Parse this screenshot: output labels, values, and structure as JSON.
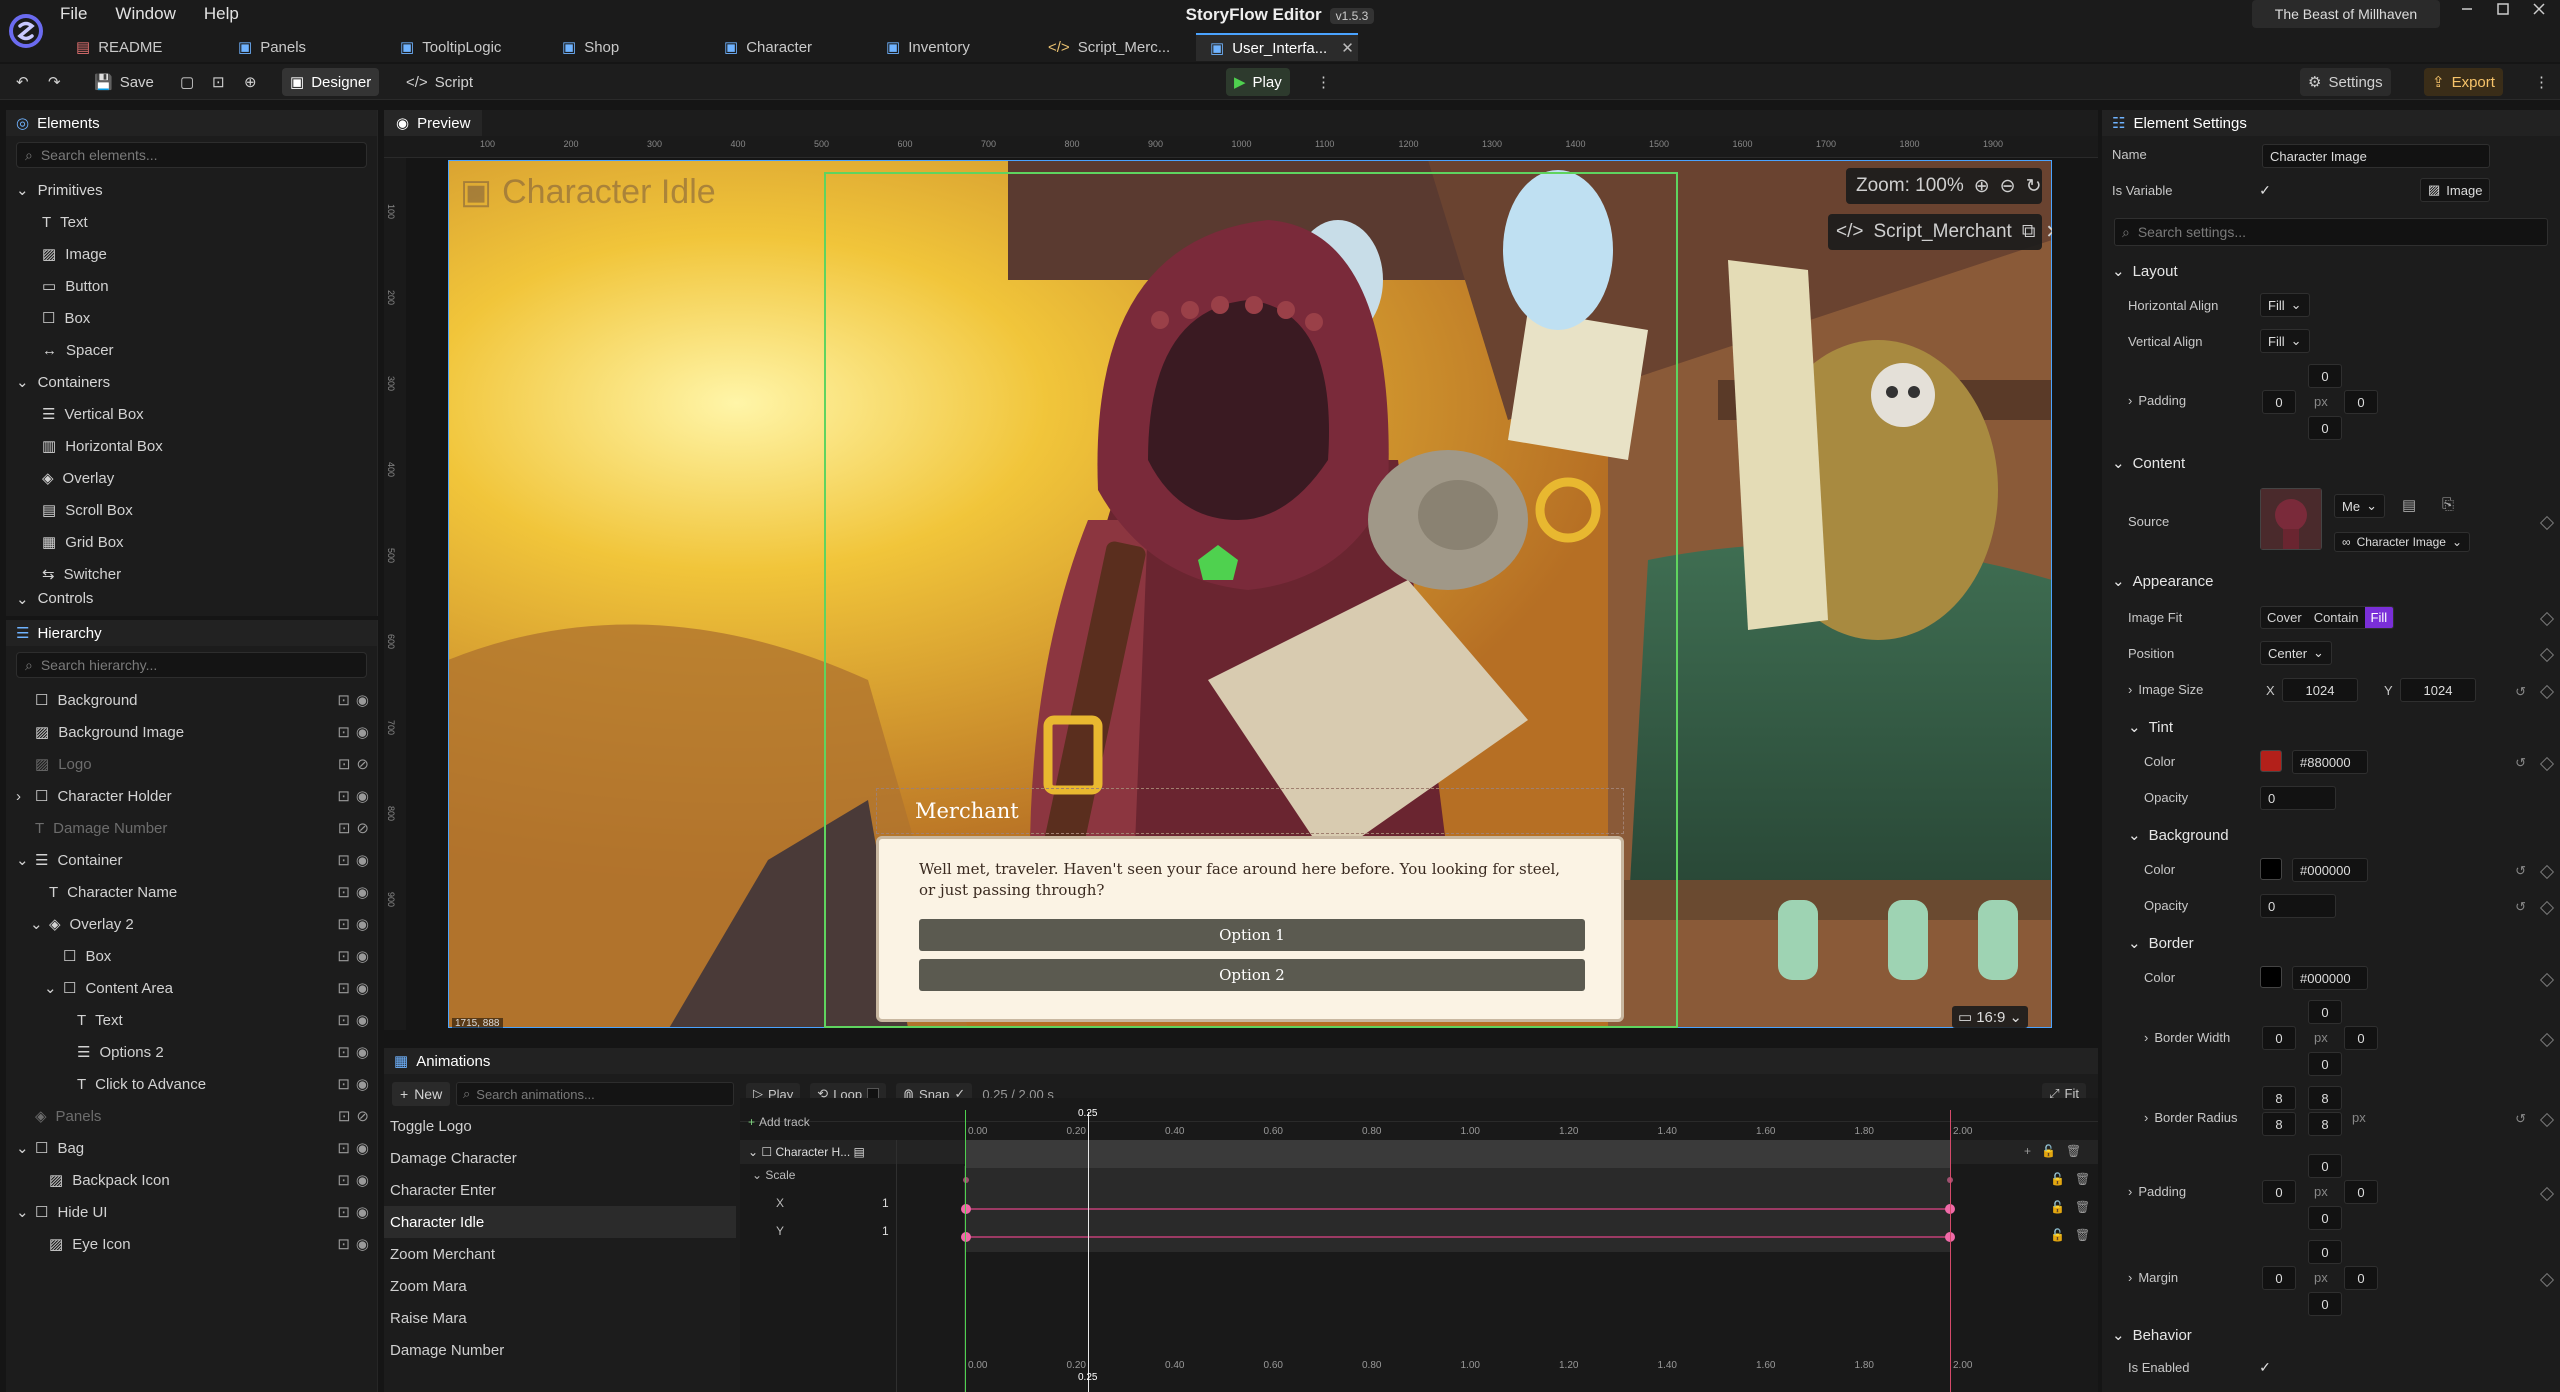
{
  "app": {
    "title": "StoryFlow Editor",
    "version": "v1.5.3",
    "project": "The Beast of Millhaven",
    "menu": [
      "File",
      "Window",
      "Help"
    ]
  },
  "tabs": [
    {
      "label": "README",
      "icon": "file-icon"
    },
    {
      "label": "Panels",
      "icon": "layout-icon"
    },
    {
      "label": "TooltipLogic",
      "icon": "layout-icon"
    },
    {
      "label": "Shop",
      "icon": "layout-icon"
    },
    {
      "label": "Character",
      "icon": "layout-icon"
    },
    {
      "label": "Inventory",
      "icon": "layout-icon"
    },
    {
      "label": "Script_Merc...",
      "icon": "code-icon"
    },
    {
      "label": "User_Interfa...",
      "icon": "layout-icon",
      "active": true
    }
  ],
  "toolbar": {
    "save": "Save",
    "designer": "Designer",
    "script": "Script",
    "play": "Play",
    "settings": "Settings",
    "export": "Export"
  },
  "elements": {
    "title": "Elements",
    "search_placeholder": "Search elements...",
    "primitives_label": "Primitives",
    "primitives": [
      "Text",
      "Image",
      "Button",
      "Box",
      "Spacer"
    ],
    "containers_label": "Containers",
    "containers": [
      "Vertical Box",
      "Horizontal Box",
      "Overlay",
      "Scroll Box",
      "Grid Box",
      "Switcher"
    ],
    "controls_label": "Controls"
  },
  "hierarchy": {
    "title": "Hierarchy",
    "search_placeholder": "Search hierarchy...",
    "items": [
      {
        "label": "Background",
        "depth": 0,
        "icon": "box",
        "dim": false
      },
      {
        "label": "Background Image",
        "depth": 0,
        "icon": "image",
        "dim": false
      },
      {
        "label": "Logo",
        "depth": 0,
        "icon": "image",
        "dim": true
      },
      {
        "label": "Character Holder",
        "depth": 0,
        "icon": "box",
        "dim": false,
        "caret": "right"
      },
      {
        "label": "Damage Number",
        "depth": 0,
        "icon": "text",
        "dim": true
      },
      {
        "label": "Container",
        "depth": 0,
        "icon": "vbox",
        "dim": false,
        "caret": "down"
      },
      {
        "label": "Character Name",
        "depth": 1,
        "icon": "text",
        "dim": false
      },
      {
        "label": "Overlay 2",
        "depth": 1,
        "icon": "layers",
        "dim": false,
        "caret": "down"
      },
      {
        "label": "Box",
        "depth": 2,
        "icon": "box",
        "dim": false
      },
      {
        "label": "Content Area",
        "depth": 2,
        "icon": "box",
        "dim": false,
        "caret": "down"
      },
      {
        "label": "Text",
        "depth": 3,
        "icon": "text",
        "dim": false
      },
      {
        "label": "Options 2",
        "depth": 3,
        "icon": "vbox",
        "dim": false
      },
      {
        "label": "Click to Advance",
        "depth": 3,
        "icon": "text",
        "dim": false
      },
      {
        "label": "Panels",
        "depth": 0,
        "icon": "layers",
        "dim": true
      },
      {
        "label": "Bag",
        "depth": 0,
        "icon": "box",
        "dim": false,
        "caret": "down"
      },
      {
        "label": "Backpack Icon",
        "depth": 1,
        "icon": "image",
        "dim": false
      },
      {
        "label": "Hide UI",
        "depth": 0,
        "icon": "box",
        "dim": false,
        "caret": "down"
      },
      {
        "label": "Eye Icon",
        "depth": 1,
        "icon": "image",
        "dim": false
      }
    ]
  },
  "preview": {
    "title": "Preview",
    "overlay_title": "Character Idle",
    "zoom": "Zoom: 100%",
    "script_label": "Script_Merchant",
    "coords": "1715, 888",
    "aspect": "16:9",
    "ruler": [
      "100",
      "200",
      "300",
      "400",
      "500",
      "600",
      "700",
      "800",
      "900",
      "1000",
      "1100",
      "1200",
      "1300",
      "1400",
      "1500",
      "1600",
      "1700",
      "1800",
      "1900"
    ],
    "ruler_left": [
      "100",
      "200",
      "300",
      "400",
      "500",
      "600",
      "700",
      "800",
      "900"
    ],
    "dialog": {
      "speaker": "Merchant",
      "text": "Well met, traveler. Haven't seen your face around here before. You looking for steel, or just passing through?",
      "option1": "Option 1",
      "option2": "Option 2"
    }
  },
  "settings": {
    "title": "Element Settings",
    "name_label": "Name",
    "name_value": "Character Image",
    "is_variable": "Is Variable",
    "type_badge": "Image",
    "search_placeholder": "Search settings...",
    "layout": "Layout",
    "h_align": "Horizontal Align",
    "h_align_val": "Fill",
    "v_align": "Vertical Align",
    "v_align_val": "Fill",
    "padding": "Padding",
    "zero": "0",
    "px": "px",
    "content": "Content",
    "source": "Source",
    "source_mode": "Me",
    "source_var": "Character Image",
    "appearance": "Appearance",
    "image_fit": "Image Fit",
    "fit_opts": [
      "Cover",
      "Contain",
      "Fill"
    ],
    "position": "Position",
    "position_val": "Center",
    "image_size": "Image Size",
    "x": "X",
    "y": "Y",
    "size_x": "1024",
    "size_y": "1024",
    "tint": "Tint",
    "color": "Color",
    "tint_hex": "#880000",
    "tint_color": "#b3201a",
    "opacity": "Opacity",
    "background": "Background",
    "bg_hex": "#000000",
    "border": "Border",
    "border_hex": "#000000",
    "border_width": "Border Width",
    "border_radius": "Border Radius",
    "eight": "8",
    "margin": "Margin",
    "behavior": "Behavior",
    "is_enabled": "Is Enabled"
  },
  "animations": {
    "title": "Animations",
    "new": "New",
    "search_placeholder": "Search animations...",
    "play": "Play",
    "loop": "Loop",
    "snap": "Snap",
    "time": "0.25 / 2.00 s",
    "fit": "Fit",
    "add_track": "Add track",
    "track": "Character H...",
    "scale": "Scale",
    "x": "X",
    "y": "Y",
    "one": "1",
    "playhead": "0.25",
    "ticks": [
      "0.00",
      "0.20",
      "0.40",
      "0.60",
      "0.80",
      "1.00",
      "1.20",
      "1.40",
      "1.60",
      "1.80",
      "2.00"
    ],
    "list": [
      "Toggle Logo",
      "Damage Character",
      "Character Enter",
      "Character Idle",
      "Zoom Merchant",
      "Zoom Mara",
      "Raise Mara",
      "Damage Number"
    ],
    "selected": "Character Idle"
  }
}
